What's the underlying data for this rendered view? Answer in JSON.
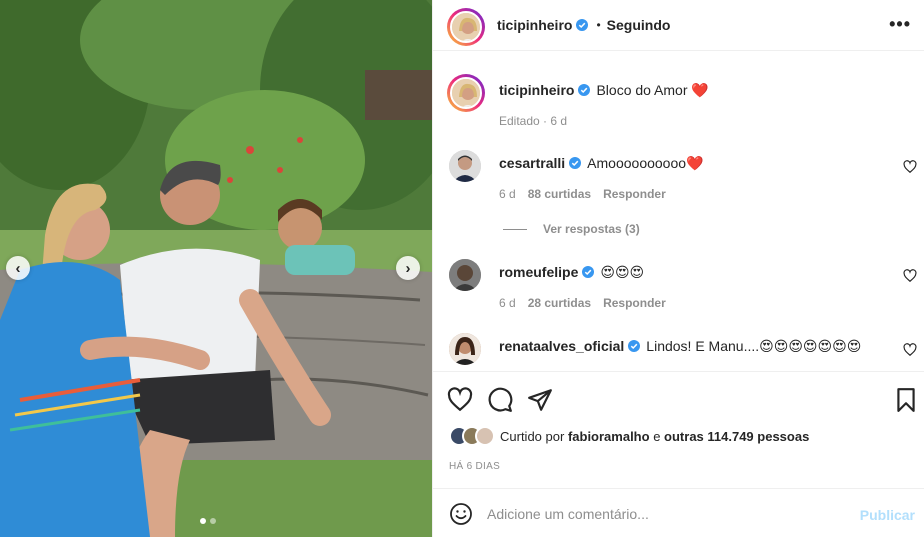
{
  "post": {
    "author": "ticipinheiro",
    "follow_state": "Seguindo",
    "more_icon": "•••",
    "caption": "Bloco do Amor",
    "caption_emoji": "❤️",
    "edited_meta": "Editado · 6 d",
    "carousel": {
      "current": 1,
      "total": 2
    }
  },
  "comments": [
    {
      "username": "cesartralli",
      "verified": true,
      "text": "Amoooooooooo",
      "emoji": "❤️",
      "time": "6 d",
      "likes": "88 curtidas",
      "reply_label": "Responder"
    },
    {
      "username": "romeufelipe",
      "verified": true,
      "text": "",
      "emoji": "😍😍😍",
      "time": "6 d",
      "likes": "28 curtidas",
      "reply_label": "Responder"
    },
    {
      "username": "renataalves_oficial",
      "verified": true,
      "text": "Lindos! E Manu....",
      "emoji": "😍😍😍😍😍😍😍",
      "time": "",
      "likes": "",
      "reply_label": ""
    }
  ],
  "replies": {
    "label": "Ver respostas (3)"
  },
  "likes": {
    "prefix": "Curtido por",
    "first_user": "fabioramalho",
    "connector": "e",
    "others": "outras 114.749 pessoas"
  },
  "date": "HÁ 6 DIAS",
  "composer": {
    "placeholder": "Adicione um comentário...",
    "publish_label": "Publicar"
  },
  "colors": {
    "verified": "#3897f0",
    "heart": "#ed4956",
    "muted": "#8e8e8e",
    "publish_disabled": "#b2dffc"
  }
}
